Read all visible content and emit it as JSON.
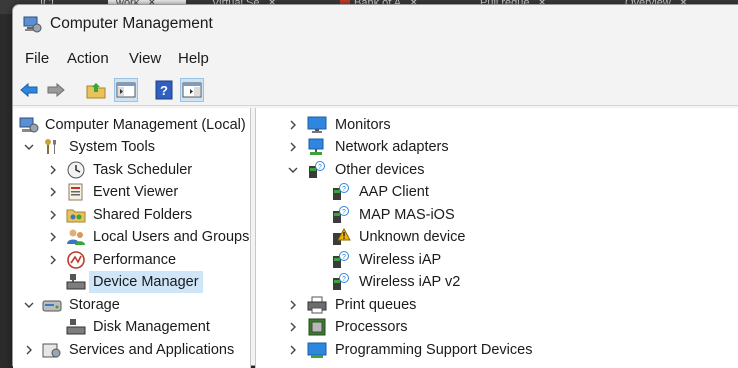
{
  "background_tabs": [
    {
      "label": "ICI"
    },
    {
      "label": "work"
    },
    {
      "label": "Virtual Se"
    },
    {
      "label": "Bank of A"
    },
    {
      "label": "Pull reque"
    },
    {
      "label": "Overview"
    }
  ],
  "window": {
    "title": "Computer Management"
  },
  "menu": [
    "File",
    "Action",
    "View",
    "Help"
  ],
  "toolbar": {
    "back": "back-arrow-icon",
    "forward": "forward-arrow-icon",
    "up": "up-folder-icon",
    "show_hide_tree": "console-tree-icon",
    "help": "help-icon",
    "action_pane": "action-pane-icon"
  },
  "tree": {
    "root": "Computer Management (Local)",
    "system_tools": "System Tools",
    "task_scheduler": "Task Scheduler",
    "event_viewer": "Event Viewer",
    "shared_folders": "Shared Folders",
    "local_users": "Local Users and Groups",
    "performance": "Performance",
    "device_manager": "Device Manager",
    "storage": "Storage",
    "disk_management": "Disk Management",
    "services": "Services and Applications"
  },
  "devices": {
    "monitors": "Monitors",
    "network_adapters": "Network adapters",
    "other_devices": "Other devices",
    "aap_client": "AAP Client",
    "map_mas_ios": "MAP MAS-iOS",
    "unknown_device": "Unknown device",
    "wireless_iap": "Wireless iAP",
    "wireless_iap_v2": "Wireless iAP v2",
    "print_queues": "Print queues",
    "processors": "Processors",
    "programming_support": "Programming Support Devices"
  },
  "colors": {
    "selection": "#cfe6f8",
    "accent": "#1e73c8",
    "warning": "#f4b400"
  }
}
